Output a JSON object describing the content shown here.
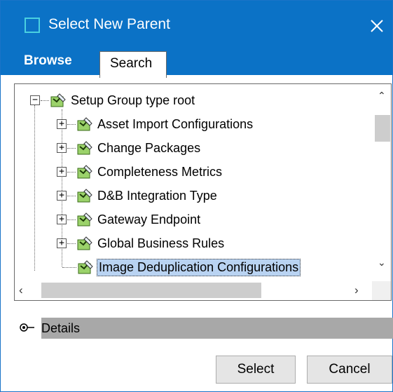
{
  "dialog": {
    "title": "Select New Parent",
    "close_icon": "close-icon"
  },
  "tabs": [
    {
      "label": "Browse",
      "active": true
    },
    {
      "label": "Search",
      "active": false
    }
  ],
  "tree": {
    "root": {
      "label": "Setup Group type root",
      "expander": "−"
    },
    "children": [
      {
        "label": "Asset Import Configurations",
        "expander": "+"
      },
      {
        "label": "Change Packages",
        "expander": "+"
      },
      {
        "label": "Completeness Metrics",
        "expander": "+"
      },
      {
        "label": "D&B Integration Type",
        "expander": "+"
      },
      {
        "label": "Gateway Endpoint",
        "expander": "+"
      },
      {
        "label": "Global Business Rules",
        "expander": "+"
      },
      {
        "label": "Image Deduplication Configurations",
        "expander": "",
        "selected": true
      }
    ]
  },
  "details": {
    "label": "Details"
  },
  "buttons": {
    "select": "Select",
    "cancel": "Cancel"
  },
  "colors": {
    "accent": "#0b72c6",
    "selection": "#b9d3f2",
    "details_bar": "#a8a8a8"
  }
}
